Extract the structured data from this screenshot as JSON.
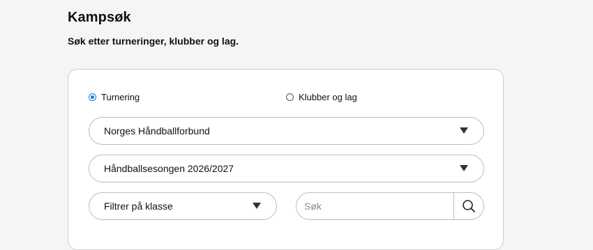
{
  "header": {
    "title": "Kampsøk",
    "subtitle": "Søk etter turneringer, klubber og lag."
  },
  "search_type": {
    "options": [
      {
        "label": "Turnering",
        "checked": true
      },
      {
        "label": "Klubber og lag",
        "checked": false
      }
    ]
  },
  "filters": {
    "federation": "Norges Håndballforbund",
    "season": "Håndballsesongen 2026/2027",
    "class": "Filtrer på klasse"
  },
  "search": {
    "placeholder": "Søk",
    "value": ""
  },
  "icons": {
    "search": "search-icon",
    "dropdown": "chevron-down-icon"
  },
  "colors": {
    "accent": "#1a73e8",
    "border": "#bdbdbd",
    "background": "#f5f5f5"
  }
}
